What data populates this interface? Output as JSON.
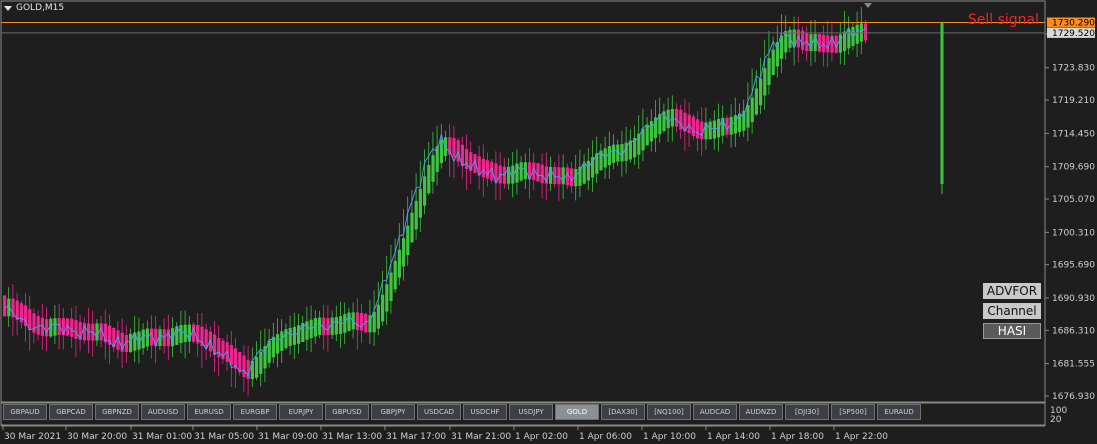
{
  "window": {
    "symbol_title": "GOLD,M15"
  },
  "annotation": {
    "sell_text": "Sell signal"
  },
  "buttons": [
    {
      "label": "ADVFOR",
      "style": "light"
    },
    {
      "label": "Channel",
      "style": "light"
    },
    {
      "label": "HASI",
      "style": "dark"
    }
  ],
  "symbol_tabs": [
    {
      "label": "GBPAUD",
      "active": false
    },
    {
      "label": "GBPCAD",
      "active": false
    },
    {
      "label": "GBPNZD",
      "active": false
    },
    {
      "label": "AUDUSD",
      "active": false
    },
    {
      "label": "EURUSD",
      "active": false
    },
    {
      "label": "EURGBP",
      "active": false
    },
    {
      "label": "EURJPY",
      "active": false
    },
    {
      "label": "GBPUSD",
      "active": false
    },
    {
      "label": "GBPJPY",
      "active": false
    },
    {
      "label": "USDCAD",
      "active": false
    },
    {
      "label": "USDCHF",
      "active": false
    },
    {
      "label": "USDJPY",
      "active": false
    },
    {
      "label": "GOLD",
      "active": true
    },
    {
      "label": "[DAX30]",
      "active": false
    },
    {
      "label": "[NQ100]",
      "active": false
    },
    {
      "label": "AUDCAD",
      "active": false
    },
    {
      "label": "AUDNZD",
      "active": false
    },
    {
      "label": "[DJI30]",
      "active": false
    },
    {
      "label": "[SP500]",
      "active": false
    },
    {
      "label": "EURAUD",
      "active": false
    }
  ],
  "colors": {
    "background": "#1e1e1e",
    "bull": "#3ec43e",
    "bear": "#f0248c",
    "close_line": "#4aa0ff",
    "current_price_line": "#ff8c1a",
    "signal": "#ff2020"
  },
  "chart_data": {
    "type": "candlestick",
    "symbol": "GOLD",
    "timeframe": "M15",
    "price_ticks": [
      "1729.520",
      "1723.830",
      "1719.210",
      "1714.450",
      "1709.690",
      "1705.070",
      "1700.310",
      "1695.690",
      "1690.930",
      "1686.310",
      "1681.555",
      "1676.930"
    ],
    "tick_values": [
      1729.52,
      1723.83,
      1719.21,
      1714.45,
      1709.69,
      1705.07,
      1700.31,
      1695.69,
      1690.93,
      1686.31,
      1681.555,
      1676.93
    ],
    "ylim": [
      1676.0,
      1731.0
    ],
    "current_price_label": "1730.290",
    "current_price": 1730.29,
    "ask_price_label": "1729.520",
    "time_ticks": [
      "30 Mar 2021",
      "30 Mar 20:00",
      "31 Mar 01:00",
      "31 Mar 05:00",
      "31 Mar 09:00",
      "31 Mar 13:00",
      "31 Mar 17:00",
      "31 Mar 21:00",
      "1 Apr 02:00",
      "1 Apr 06:00",
      "1 Apr 10:00",
      "1 Apr 14:00",
      "1 Apr 18:00",
      "1 Apr 22:00"
    ],
    "sub_indicator_ticks": [
      "100",
      "20"
    ],
    "close_anchors": [
      [
        0,
        1689.5
      ],
      [
        5,
        1687.2
      ],
      [
        12,
        1686.6
      ],
      [
        20,
        1686.2
      ],
      [
        26,
        1684.6
      ],
      [
        32,
        1685.0
      ],
      [
        40,
        1685.8
      ],
      [
        46,
        1685.5
      ],
      [
        52,
        1682.5
      ],
      [
        57,
        1680.3
      ],
      [
        60,
        1682.6
      ],
      [
        66,
        1685.7
      ],
      [
        72,
        1686.5
      ],
      [
        80,
        1687.6
      ],
      [
        86,
        1687.0
      ],
      [
        89,
        1691.0
      ],
      [
        93,
        1697.0
      ],
      [
        97,
        1705.0
      ],
      [
        101,
        1711.0
      ],
      [
        104,
        1713.2
      ],
      [
        108,
        1711.0
      ],
      [
        112,
        1709.1
      ],
      [
        118,
        1708.6
      ],
      [
        124,
        1709.0
      ],
      [
        128,
        1708.7
      ],
      [
        131,
        1708.2
      ],
      [
        134,
        1707.7
      ],
      [
        138,
        1710.0
      ],
      [
        143,
        1711.3
      ],
      [
        148,
        1712.5
      ],
      [
        153,
        1715.0
      ],
      [
        157,
        1717.5
      ],
      [
        161,
        1715.5
      ],
      [
        164,
        1714.5
      ],
      [
        168,
        1715.6
      ],
      [
        172,
        1715.2
      ],
      [
        175,
        1716.5
      ],
      [
        179,
        1722.0
      ],
      [
        183,
        1726.8
      ],
      [
        186,
        1728.9
      ],
      [
        189,
        1727.4
      ],
      [
        193,
        1727.0
      ],
      [
        197,
        1727.5
      ],
      [
        200,
        1728.3
      ],
      [
        205,
        1729.0
      ]
    ],
    "signal_bar": {
      "high": 1730.29,
      "low": 1707.2
    }
  }
}
